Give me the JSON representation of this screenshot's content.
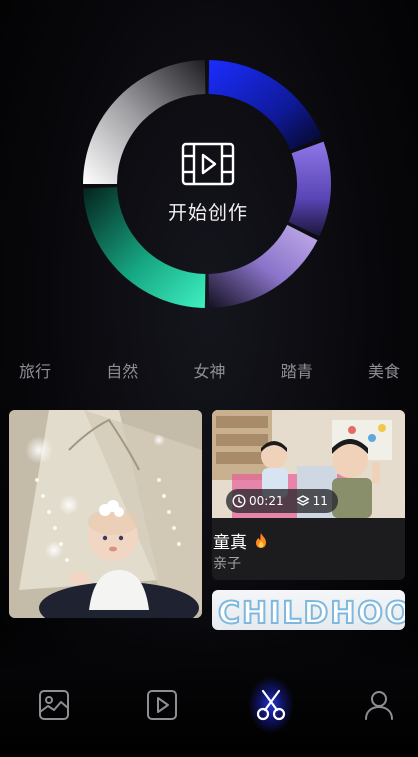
{
  "create": {
    "label": "开始创作",
    "icon": "video-edit-icon"
  },
  "ring": {
    "colors": {
      "blue": "#1a2cff",
      "purple": "#7b63d6",
      "lavender": "#b9a3e6",
      "teal": "#2ee0b3",
      "silver": "#f2f2f2"
    }
  },
  "categories": [
    "旅行",
    "自然",
    "女神",
    "踏青",
    "美食"
  ],
  "feed": {
    "card1": {
      "duration": "00:21",
      "layers": "11",
      "title": "童真",
      "title_icon": "fire-icon",
      "subtitle": "亲子"
    },
    "card2": {
      "overlay_text": "CHILDHOOD"
    }
  },
  "nav": {
    "items": [
      {
        "name": "gallery",
        "icon": "image-icon"
      },
      {
        "name": "video",
        "icon": "play-icon"
      },
      {
        "name": "edit",
        "icon": "scissors-icon",
        "active": true
      },
      {
        "name": "profile",
        "icon": "user-icon"
      }
    ],
    "accent": "#2a3cff"
  }
}
